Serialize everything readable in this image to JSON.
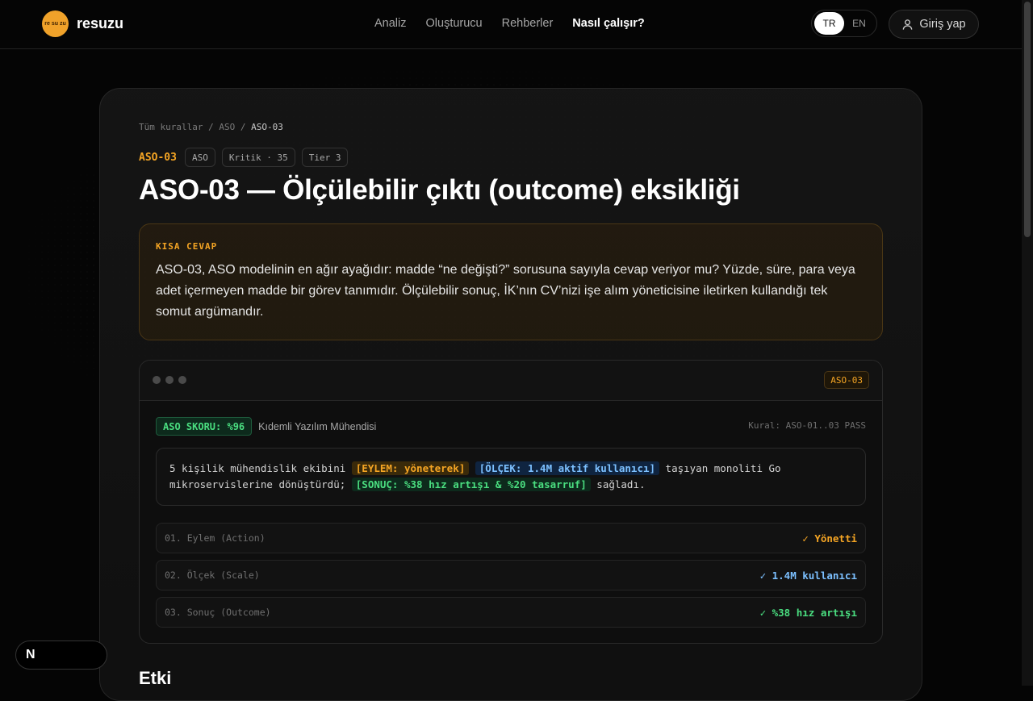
{
  "header": {
    "logo_mark": "re su zu",
    "logo_text": "resuzu",
    "nav": [
      {
        "label": "Analiz",
        "active": false
      },
      {
        "label": "Oluşturucu",
        "active": false
      },
      {
        "label": "Rehberler",
        "active": false
      },
      {
        "label": "Nasıl çalışır?",
        "active": true
      }
    ],
    "lang": {
      "tr": "TR",
      "en": "EN",
      "selected": "TR"
    },
    "login_label": "Giriş yap",
    "login_icon": "user-icon"
  },
  "breadcrumb": {
    "root": "Tüm kurallar",
    "sep": "/",
    "group": "ASO",
    "current": "ASO-03"
  },
  "tags": {
    "id": "ASO-03",
    "category": "ASO",
    "severity": "Kritik · 35",
    "tier": "Tier 3"
  },
  "title": "ASO-03 — Ölçülebilir çıktı (outcome) eksikliği",
  "short_answer": {
    "label": "KISA CEVAP",
    "text": "ASO-03, ASO modelinin en ağır ayağıdır: madde “ne değişti?” sorusuna sayıyla cevap veriyor mu? Yüzde, süre, para veya adet içermeyen madde bir görev tanımıdır. Ölçülebilir sonuç, İK’nın CV’nizi işe alım yöneticisine iletirken kullandığı tek somut argümandır."
  },
  "demo": {
    "badge": "ASO-03",
    "score": "ASO SKORU: %96",
    "role": "Kıdemli Yazılım Mühendisi",
    "rules_pass": "Kural: ASO-01..03 PASS",
    "sentence": {
      "part1": "5 kişilik mühendislik ekibini ",
      "action": "[EYLEM: yöneterek]",
      "scale": "[ÖLÇEK: 1.4M aktif kullanıcı]",
      "part2": " taşıyan monoliti Go mikroservislerine dönüştürdü; ",
      "outcome": "[SONUÇ: %38 hız artışı & %20 tasarruf]",
      "part3": " sağladı."
    },
    "checks": [
      {
        "label": "01. Eylem (Action)",
        "value": "✓ Yönetti"
      },
      {
        "label": "02. Ölçek (Scale)",
        "value": "✓ 1.4M kullanıcı"
      },
      {
        "label": "03. Sonuç (Outcome)",
        "value": "✓ %38 hız artışı"
      }
    ]
  },
  "next_section": "Etki",
  "dev_badge": "N",
  "colors": {
    "accent": "#f5a524",
    "scale": "#7cc0ff",
    "outcome": "#4ade80",
    "background": "#050505"
  }
}
